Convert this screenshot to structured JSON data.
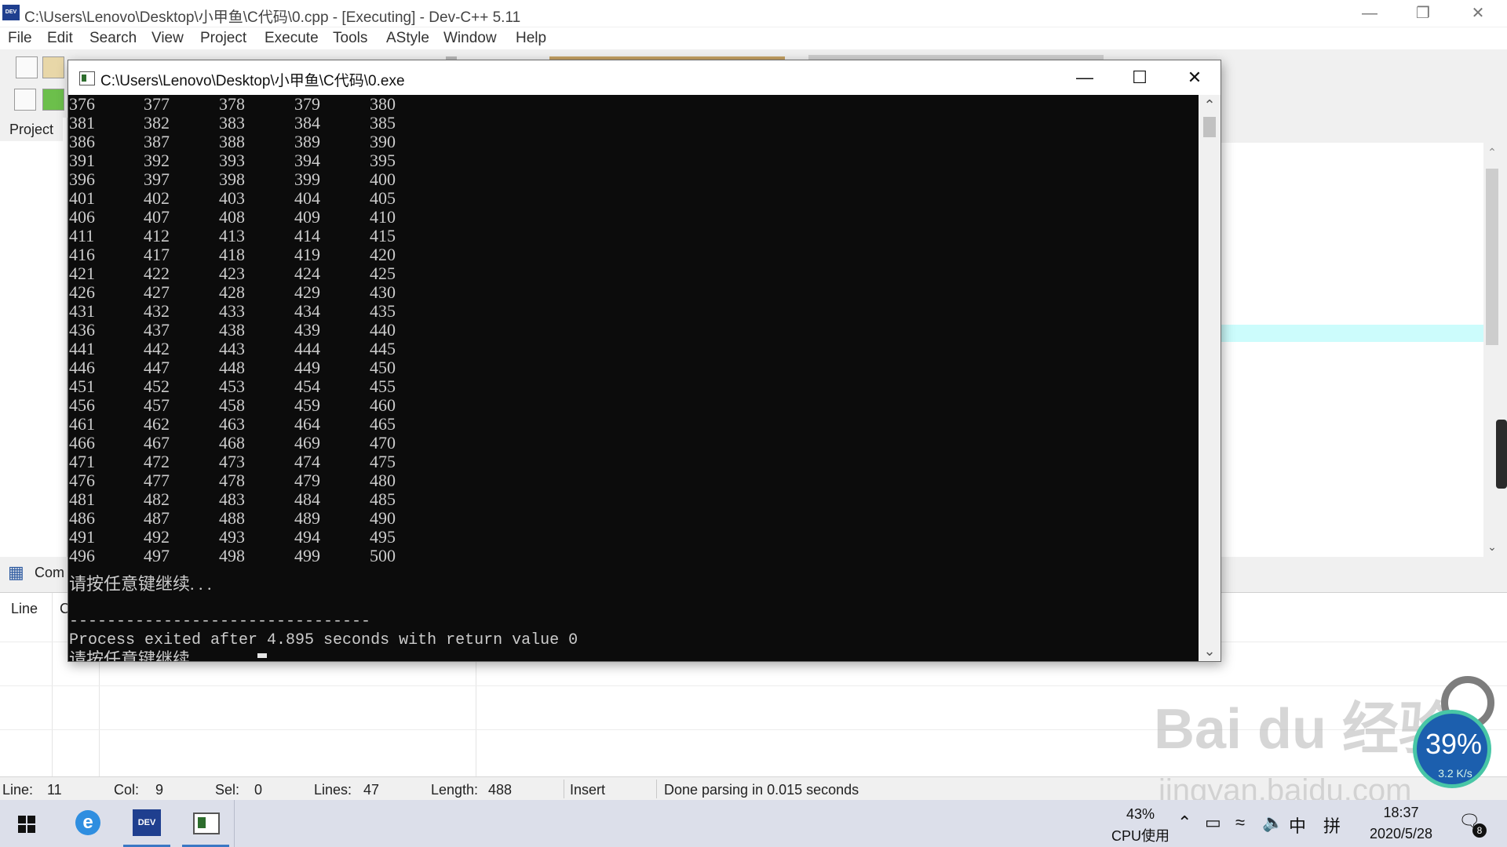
{
  "ide": {
    "title": "C:\\Users\\Lenovo\\Desktop\\小甲鱼\\C代码\\0.cpp - [Executing] - Dev-C++ 5.11",
    "app_icon_text": "DEV",
    "menu": [
      "File",
      "Edit",
      "Search",
      "View",
      "Project",
      "Execute",
      "Tools",
      "AStyle",
      "Window",
      "Help"
    ],
    "project_tab": "Project",
    "bottom_tab": "Com",
    "msg_headers": {
      "line": "Line",
      "col": "C"
    }
  },
  "console": {
    "title": "C:\\Users\\Lenovo\\Desktop\\小甲鱼\\C代码\\0.exe",
    "rows": [
      [
        "376",
        "377",
        "378",
        "379",
        "380"
      ],
      [
        "381",
        "382",
        "383",
        "384",
        "385"
      ],
      [
        "386",
        "387",
        "388",
        "389",
        "390"
      ],
      [
        "391",
        "392",
        "393",
        "394",
        "395"
      ],
      [
        "396",
        "397",
        "398",
        "399",
        "400"
      ],
      [
        "401",
        "402",
        "403",
        "404",
        "405"
      ],
      [
        "406",
        "407",
        "408",
        "409",
        "410"
      ],
      [
        "411",
        "412",
        "413",
        "414",
        "415"
      ],
      [
        "416",
        "417",
        "418",
        "419",
        "420"
      ],
      [
        "421",
        "422",
        "423",
        "424",
        "425"
      ],
      [
        "426",
        "427",
        "428",
        "429",
        "430"
      ],
      [
        "431",
        "432",
        "433",
        "434",
        "435"
      ],
      [
        "436",
        "437",
        "438",
        "439",
        "440"
      ],
      [
        "441",
        "442",
        "443",
        "444",
        "445"
      ],
      [
        "446",
        "447",
        "448",
        "449",
        "450"
      ],
      [
        "451",
        "452",
        "453",
        "454",
        "455"
      ],
      [
        "456",
        "457",
        "458",
        "459",
        "460"
      ],
      [
        "461",
        "462",
        "463",
        "464",
        "465"
      ],
      [
        "466",
        "467",
        "468",
        "469",
        "470"
      ],
      [
        "471",
        "472",
        "473",
        "474",
        "475"
      ],
      [
        "476",
        "477",
        "478",
        "479",
        "480"
      ],
      [
        "481",
        "482",
        "483",
        "484",
        "485"
      ],
      [
        "486",
        "487",
        "488",
        "489",
        "490"
      ],
      [
        "491",
        "492",
        "493",
        "494",
        "495"
      ],
      [
        "496",
        "497",
        "498",
        "499",
        "500"
      ]
    ],
    "press_key": "请按任意键继续. . .",
    "separator": "--------------------------------",
    "process_exit": "Process exited after 4.895 seconds with return value 0",
    "press_key2": "请按任意键继续. . ."
  },
  "statusbar": {
    "line_label": "Line:",
    "line_value": "11",
    "col_label": "Col:",
    "col_value": "9",
    "sel_label": "Sel:",
    "sel_value": "0",
    "lines_label": "Lines:",
    "lines_value": "47",
    "length_label": "Length:",
    "length_value": "488",
    "mode": "Insert",
    "message": "Done parsing in 0.015 seconds"
  },
  "watermark": {
    "brand": "Bai du 经验",
    "url": "jingyan.baidu.com"
  },
  "widget": {
    "percent": "39%",
    "speed": "3.2 K/s"
  },
  "taskbar": {
    "cpu_percent": "43%",
    "cpu_label": "CPU使用",
    "ime1": "中",
    "ime2": "拼",
    "time": "18:37",
    "date": "2020/5/28",
    "notifications": "8",
    "dev_icon_text": "DEV"
  },
  "colors": {
    "console_bg": "#0c0c0c",
    "console_text": "#cccccc",
    "highlight_line": "#ccfcfc",
    "widget_blue": "#1c5fae"
  }
}
